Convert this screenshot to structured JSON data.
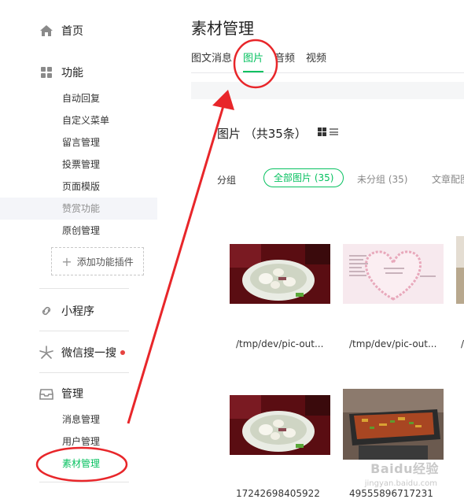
{
  "sidebar": {
    "home": {
      "label": "首页",
      "icon": "home-icon"
    },
    "features": {
      "label": "功能",
      "icon": "grid-icon",
      "items": [
        "自动回复",
        "自定义菜单",
        "留言管理",
        "投票管理",
        "页面模版",
        "赞赏功能",
        "原创管理"
      ],
      "add_plugin": "添加功能插件"
    },
    "mini_program": {
      "label": "小程序",
      "icon": "link-icon"
    },
    "wechat_search": {
      "label": "微信搜一搜",
      "icon": "sparkle-icon"
    },
    "manage": {
      "label": "管理",
      "icon": "inbox-icon",
      "items": [
        "消息管理",
        "用户管理",
        "素材管理"
      ]
    }
  },
  "main": {
    "title": "素材管理",
    "tabs": [
      "图文消息",
      "图片",
      "音频",
      "视频"
    ],
    "section_title": "图片 （共35条）",
    "group_label": "分组",
    "filters": [
      "全部图片 (35)",
      "未分组 (35)",
      "文章配图"
    ],
    "images": [
      {
        "caption": "/tmp/dev/pic-out...",
        "kind": "soup"
      },
      {
        "caption": "/tmp/dev/pic-out...",
        "kind": "heart"
      },
      {
        "caption": "/",
        "kind": "partial"
      },
      {
        "caption": "17242698405922",
        "kind": "soup"
      },
      {
        "caption": "49555896717231",
        "kind": "grill"
      }
    ]
  },
  "watermark": {
    "main": "Baidu经验",
    "sub": "jingyan.baidu.com"
  },
  "colors": {
    "accent": "#07c160",
    "annotation": "#e8262a"
  }
}
